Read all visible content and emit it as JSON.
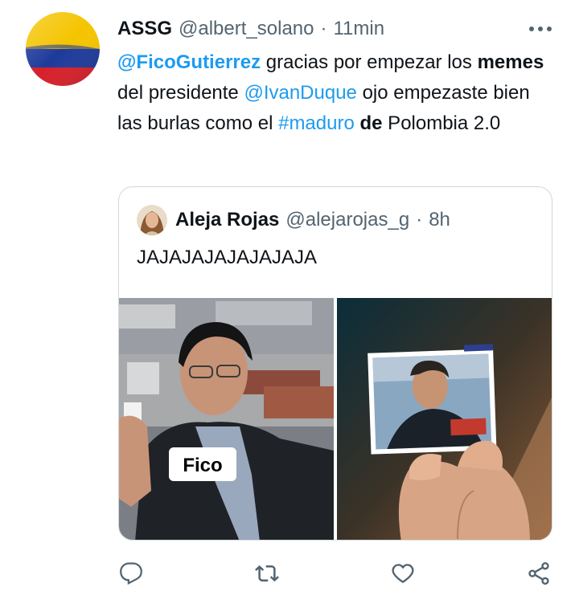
{
  "tweet": {
    "author_name": "ASSG",
    "handle": "@albert_solano",
    "separator": "·",
    "time": "11min",
    "text": {
      "mention1": "@FicoGutierrez",
      "part1": " gracias por empezar los ",
      "bold1": "memes",
      "part2": " del presidente ",
      "mention2": "@IvanDuque",
      "part3": " ojo empezaste bien las burlas como el ",
      "hashtag": "#maduro",
      "part4": " ",
      "bold2": "de",
      "part5": " Polombia 2.0"
    }
  },
  "quoted": {
    "author_name": "Aleja Rojas",
    "handle": "@alejarojas_g",
    "separator": "·",
    "time": "8h",
    "text": "JAJAJAJAJAJAJAJA",
    "image_left_label": "Fico"
  },
  "colors": {
    "link": "#1d9bf0",
    "secondary_text": "#536471",
    "border": "#cfd9de",
    "flag_yellow": "#f5c400",
    "flag_blue": "#1e3a9a",
    "flag_red": "#d6202a"
  },
  "icons": [
    "more-icon",
    "reply-icon",
    "retweet-icon",
    "like-icon",
    "share-icon"
  ]
}
